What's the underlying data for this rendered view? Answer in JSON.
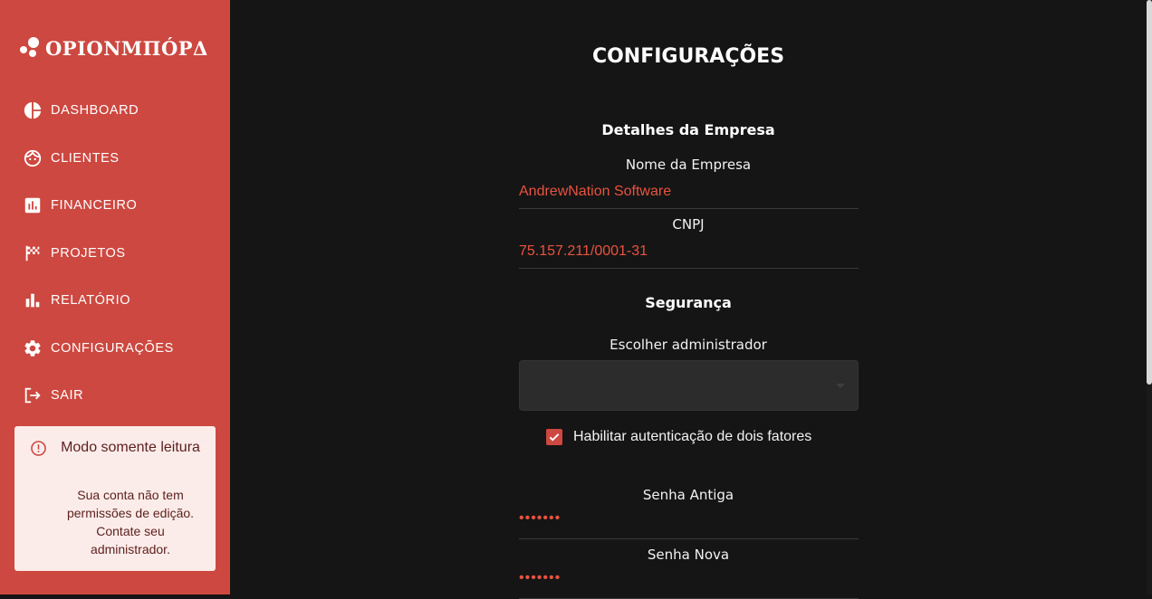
{
  "brand": {
    "logo_text": "OPIONMΠÓPΔ",
    "accent_color": "#cd4840"
  },
  "sidebar": {
    "items": [
      {
        "label": "DASHBOARD",
        "icon": "pie-chart-icon"
      },
      {
        "label": "CLIENTES",
        "icon": "face-icon"
      },
      {
        "label": "FINANCEIRO",
        "icon": "bar-chart-box-icon"
      },
      {
        "label": "PROJETOS",
        "icon": "checkered-flag-icon"
      },
      {
        "label": "RELATÓRIO",
        "icon": "bar-chart-icon"
      },
      {
        "label": "CONFIGURAÇÕES",
        "icon": "gear-icon"
      },
      {
        "label": "SAIR",
        "icon": "logout-icon"
      }
    ],
    "readonly_notice": {
      "icon": "alert-circle-icon",
      "title": "Modo somente leitura",
      "message": "Sua conta não tem permissões de edição. Contate seu administrador."
    }
  },
  "main": {
    "title": "CONFIGURAÇÕES",
    "company_section": {
      "title": "Detalhes da Empresa",
      "name_label": "Nome da Empresa",
      "name_value": "AndrewNation Software",
      "cnpj_label": "CNPJ",
      "cnpj_value": "75.157.211/0001-31"
    },
    "security_section": {
      "title": "Segurança",
      "admin_label": "Escolher administrador",
      "admin_value": "",
      "two_factor_label": "Habilitar autenticação de dois fatores",
      "two_factor_checked": true,
      "old_password_label": "Senha Antiga",
      "old_password_value": "•••••••",
      "new_password_label": "Senha Nova",
      "new_password_value": "•••••••"
    }
  }
}
